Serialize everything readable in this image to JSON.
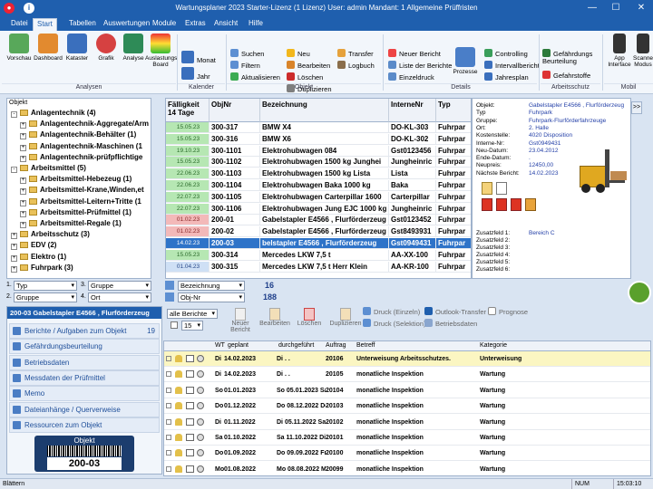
{
  "titlebar": {
    "title": "Wartungsplaner 2023 Starter-Lizenz (1 Lizenz)   User: admin   Mandant: 1 Allgemeine Prüffristen",
    "min": "—",
    "max": "☐",
    "close": "✕"
  },
  "menu": [
    "Datei",
    "Start",
    "Tabellen",
    "Auswertungen",
    "Module",
    "Extras",
    "Ansicht",
    "Hilfe"
  ],
  "ribbon": {
    "analysen": {
      "label": "Analysen",
      "buttons": [
        "Vorschau",
        "Dashboard",
        "Kataster",
        "Grafik",
        "Analyse",
        "Auslastungs Board"
      ]
    },
    "kalender": {
      "label": "Kalender",
      "buttons": [
        "Monat",
        "Jahr"
      ]
    },
    "search": [
      "Suchen",
      "Filtern",
      "Aktualisieren"
    ],
    "objekt": {
      "label": "Objekt",
      "buttons": [
        "Neu",
        "Bearbeiten",
        "Löschen",
        "Duplizieren",
        "Transfer",
        "Logbuch"
      ]
    },
    "details": {
      "label": "Details",
      "buttons": [
        "Neuer Bericht",
        "Liste der Berichte",
        "Einzeldruck",
        "Prozesse",
        "Controlling",
        "Intervallbericht",
        "Jahresplan"
      ]
    },
    "arbeitsschutz": {
      "label": "Arbeitsschutz",
      "buttons": [
        "Gefährdungs Beurteilung",
        "Gefahrstoffe"
      ]
    },
    "mobil": {
      "label": "Mobil",
      "buttons": [
        "App Interface",
        "Scanner Modus"
      ]
    }
  },
  "tree": {
    "header": "Objekt",
    "items": [
      {
        "label": "Anlagentechnik  (4)",
        "level": 0,
        "exp": "-"
      },
      {
        "label": "Anlagentechnik-Aggregate/Arm",
        "level": 1,
        "exp": "+"
      },
      {
        "label": "Anlagentechnik-Behälter  (1)",
        "level": 1,
        "exp": "+"
      },
      {
        "label": "Anlagentechnik-Maschinen  (1",
        "level": 1,
        "exp": "+"
      },
      {
        "label": "Anlagentechnik-prüfpflichtige",
        "level": 1,
        "exp": "+"
      },
      {
        "label": "Arbeitsmittel  (5)",
        "level": 0,
        "exp": "-"
      },
      {
        "label": "Arbeitsmittel-Hebezeug  (1)",
        "level": 1,
        "exp": "+"
      },
      {
        "label": "Arbeitsmittel-Krane,Winden,et",
        "level": 1,
        "exp": "+"
      },
      {
        "label": "Arbeitsmittel-Leitern+Tritte  (1",
        "level": 1,
        "exp": "+"
      },
      {
        "label": "Arbeitsmittel-Prüfmittel  (1)",
        "level": 1,
        "exp": "+"
      },
      {
        "label": "Arbeitsmittel-Regale  (1)",
        "level": 1,
        "exp": "+"
      },
      {
        "label": "Arbeitsschutz  (3)",
        "level": 0,
        "exp": "+"
      },
      {
        "label": "EDV  (2)",
        "level": 0,
        "exp": "+"
      },
      {
        "label": "Elektro  (1)",
        "level": 0,
        "exp": "+"
      },
      {
        "label": "Fuhrpark  (3)",
        "level": 0,
        "exp": "+"
      }
    ]
  },
  "groupers": [
    {
      "n": "1.",
      "v": "Typ"
    },
    {
      "n": "3.",
      "v": "Gruppe"
    },
    {
      "n": "2.",
      "v": "Gruppe"
    },
    {
      "n": "4.",
      "v": "Ort"
    }
  ],
  "grid": {
    "headers": [
      "Fälligkeit 14 Tage",
      "ObjNr",
      "Bezeichnung",
      "InterneNr",
      "Typ"
    ],
    "rows": [
      {
        "d": "15.05.23",
        "c": "g",
        "nr": "300-317",
        "bez": "BMW X4",
        "int": "DO-KL-303",
        "typ": "Fuhrpar"
      },
      {
        "d": "15.05.23",
        "c": "g",
        "nr": "300-316",
        "bez": "BMW X6",
        "int": "DO-KL-302",
        "typ": "Fuhrpar"
      },
      {
        "d": "19.10.23",
        "c": "g",
        "nr": "300-1101",
        "bez": "Elektrohubwagen 084",
        "int": "Gst0123456",
        "typ": "Fuhrpar"
      },
      {
        "d": "15.05.23",
        "c": "g",
        "nr": "300-1102",
        "bez": "Elektrohubwagen 1500 kg  Junghei",
        "int": "Jungheinric",
        "typ": "Fuhrpar"
      },
      {
        "d": "22.06.23",
        "c": "g",
        "nr": "300-1103",
        "bez": "Elektrohubwagen 1500 kg Lista",
        "int": "Lista",
        "typ": "Fuhrpar"
      },
      {
        "d": "22.06.23",
        "c": "g",
        "nr": "300-1104",
        "bez": "Elektrohubwagen Baka 1000 kg",
        "int": "Baka",
        "typ": "Fuhrpar"
      },
      {
        "d": "22.07.23",
        "c": "g",
        "nr": "300-1105",
        "bez": "Elektrohubwagen Carterpillar 1600",
        "int": "Carterpillar",
        "typ": "Fuhrpar"
      },
      {
        "d": "22.07.23",
        "c": "g",
        "nr": "300-1106",
        "bez": "Elektrohubwagen Jung EJC 1000 kg",
        "int": "Jungheinric",
        "typ": "Fuhrpar"
      },
      {
        "d": "01.02.23",
        "c": "r",
        "nr": "200-01",
        "bez": "Gabelstapler E4566 , Flurförderzeug",
        "int": "Gst0123452",
        "typ": "Fuhrpar"
      },
      {
        "d": "01.02.23",
        "c": "r",
        "nr": "200-02",
        "bez": "Gabelstapler E4566 , Flurförderzeug",
        "int": "Gst8493931",
        "typ": "Fuhrpar"
      },
      {
        "d": "14.02.23",
        "c": "r",
        "nr": "200-03",
        "bez": "belstapler E4566 , Flurförderzeug",
        "int": "Gst0949431",
        "typ": "Fuhrpar",
        "sel": true
      },
      {
        "d": "15.05.23",
        "c": "g",
        "nr": "300-314",
        "bez": "Mercedes LKW 7,5 t",
        "int": "AA-XX-100",
        "typ": "Fuhrpar"
      },
      {
        "d": "01.04.23",
        "c": "b",
        "nr": "300-315",
        "bez": "Mercedes LKW 7,5 t Herr Klein",
        "int": "AA-KR-100",
        "typ": "Fuhrpar"
      }
    ]
  },
  "detail": {
    "fields": [
      {
        "l": "Objekt:",
        "v": "Gabelstapler E4566 , Flurförderzeug"
      },
      {
        "l": "Typ",
        "v": "Fuhrpark"
      },
      {
        "l": "Gruppe:",
        "v": "Fuhrpark-Flurförderfahrzeuge"
      },
      {
        "l": "Ort:",
        "v": "2. Halle"
      },
      {
        "l": "Kostenstelle:",
        "v": "4020 Disposition"
      },
      {
        "l": "Interne-Nr:",
        "v": "Gst0949431"
      },
      {
        "l": "Neu-Datum:",
        "v": "23.04.2012"
      },
      {
        "l": "Ende-Datum:",
        "v": "."
      },
      {
        "l": "Neupreis:",
        "v": "12450,00"
      },
      {
        "l": "Nächste Bericht:",
        "v": "14.02.2023"
      }
    ],
    "extra": [
      {
        "l": "Zusatzfeld 1:",
        "v": "Bereich C"
      },
      {
        "l": "Zusatzfeld 2:",
        "v": ""
      },
      {
        "l": "Zusatzfeld 3:",
        "v": ""
      },
      {
        "l": "Zusatzfeld 4:",
        "v": ""
      },
      {
        "l": "Zusatzfeld 5:",
        "v": ""
      },
      {
        "l": "Zusatzfeld 6:",
        "v": ""
      }
    ],
    "expand": ">>"
  },
  "sortbar": {
    "sort1": "Bezeichnung",
    "sort2": "Obj-Nr",
    "count1": "16",
    "count2": "188"
  },
  "nav": {
    "title": "200-03 Gabelstapler E4566 , Flurförderzeug",
    "items": [
      {
        "label": "Berichte / Aufgaben zum Objekt",
        "count": "19"
      },
      {
        "label": "Gefährdungsbeurteilung",
        "count": ""
      },
      {
        "label": "Betriebsdaten",
        "count": ""
      },
      {
        "label": "Messdaten der Prüfmittel",
        "count": ""
      },
      {
        "label": "Memo",
        "count": ""
      },
      {
        "label": "Dateianhänge / Querverweise",
        "count": ""
      },
      {
        "label": "Ressourcen zum Objekt",
        "count": ""
      }
    ],
    "barcode_title": "Objekt",
    "barcode_value": "200-03"
  },
  "reports_toolbar": {
    "filter": "alle Berichte",
    "spinner": "15",
    "buttons": [
      "Neuer Bericht",
      "Bearbeiten",
      "Löschen",
      "Duplizieren"
    ],
    "side": [
      "Druck (Einzeln)",
      "Druck (Selektion)",
      "Outlook-Transfer",
      "Betriebsdaten",
      "Prognose"
    ]
  },
  "reports": {
    "headers": [
      "WT",
      "geplant",
      "durchgeführt",
      "Auftrag",
      "Betreff",
      "Kategorie"
    ],
    "rows": [
      {
        "wt": "Di",
        "plan": "14.02.2023",
        "done": "Di  . .",
        "auf": "20106",
        "bet": "Unterweisung Arbeitsschutzes.",
        "kat": "Unterweisung",
        "hl": true
      },
      {
        "wt": "Di",
        "plan": "14.02.2023",
        "done": "Di  . .",
        "auf": "20105",
        "bet": "monatliche Inspektion",
        "kat": "Wartung"
      },
      {
        "wt": "So",
        "plan": "01.01.2023",
        "done": "So  05.01.2023 Sa",
        "auf": "20104",
        "bet": "monatliche Inspektion",
        "kat": "Wartung"
      },
      {
        "wt": "Do",
        "plan": "01.12.2022",
        "done": "Do  08.12.2022 Do",
        "auf": "20103",
        "bet": "monatliche Inspektion",
        "kat": "Wartung"
      },
      {
        "wt": "Di",
        "plan": "01.11.2022",
        "done": "Di  05.11.2022 Sa",
        "auf": "20102",
        "bet": "monatliche Inspektion",
        "kat": "Wartung"
      },
      {
        "wt": "Sa",
        "plan": "01.10.2022",
        "done": "Sa  11.10.2022 Di",
        "auf": "20101",
        "bet": "monatliche Inspektion",
        "kat": "Wartung"
      },
      {
        "wt": "Do",
        "plan": "01.09.2022",
        "done": "Do  09.09.2022 Fr",
        "auf": "20100",
        "bet": "monatliche Inspektion",
        "kat": "Wartung"
      },
      {
        "wt": "Mo",
        "plan": "01.08.2022",
        "done": "Mo  08.08.2022 Mo",
        "auf": "20099",
        "bet": "monatliche Inspektion",
        "kat": "Wartung"
      }
    ]
  },
  "status": {
    "left": "Blättern",
    "num": "NUM",
    "time": "15:03:10"
  }
}
